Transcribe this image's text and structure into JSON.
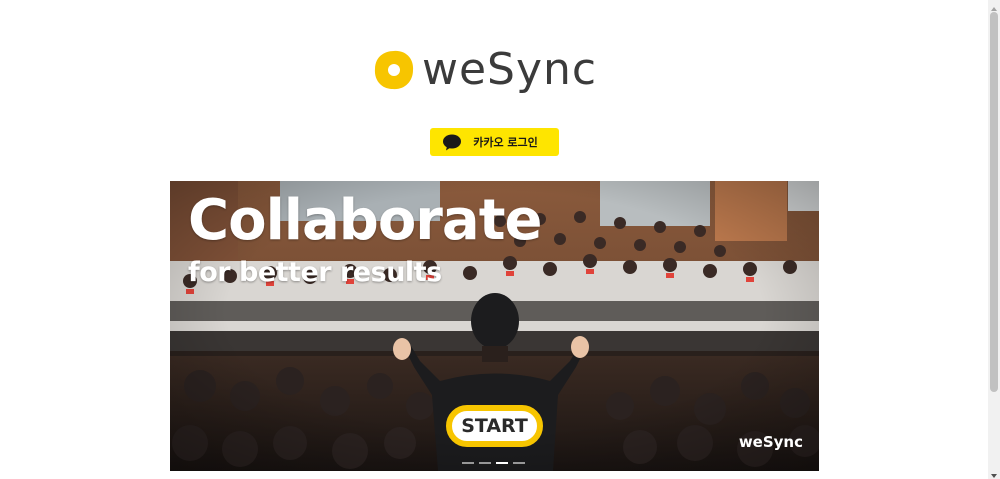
{
  "brand": {
    "logo_text": "weSync",
    "logo_color": "#3b3b3b",
    "mark_color": "#f7c500"
  },
  "login": {
    "kakao_label": "카카오 로그인",
    "kakao_color": "#fee500",
    "icon": "speech-bubble-icon"
  },
  "hero": {
    "title": "Collaborate",
    "subtitle": "for better results",
    "start_label": "START",
    "watermark": "weSync",
    "slides_total": 4,
    "slide_active": 3
  },
  "scrollbar": {
    "up_icon": "arrow-up-icon",
    "down_icon": "arrow-down-icon"
  }
}
